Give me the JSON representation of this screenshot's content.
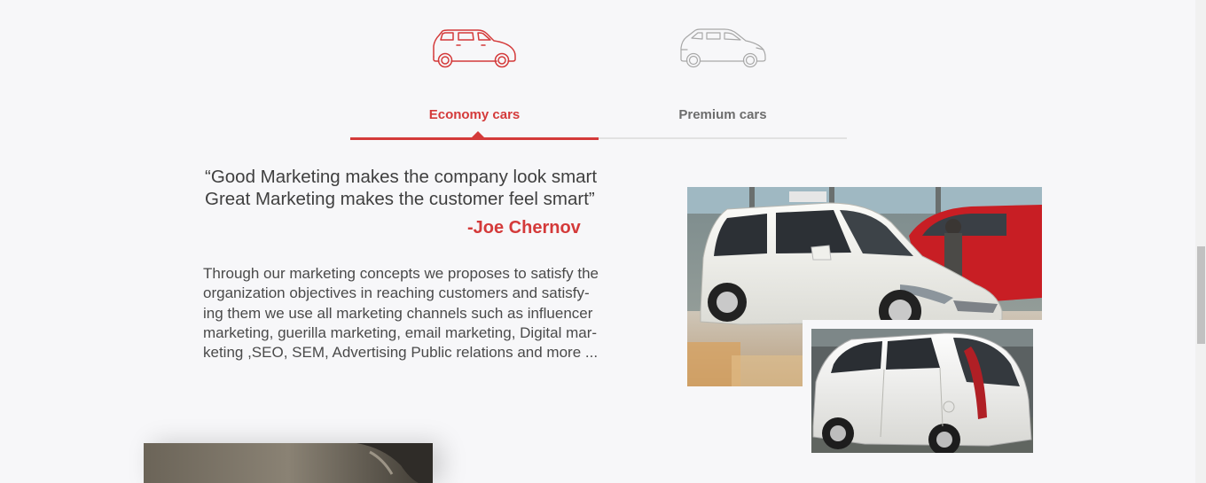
{
  "tabs": {
    "economy": {
      "label": "Economy cars",
      "active": true,
      "color": "#d43a3a"
    },
    "premium": {
      "label": "Premium cars",
      "active": false,
      "color": "#6d6d6d"
    }
  },
  "quote": {
    "line1": "“Good Marketing makes the company look smart",
    "line2": "Great Marketing makes the customer feel smart”",
    "author": "-Joe Chernov"
  },
  "description": {
    "lines": [
      "Through our marketing concepts we proposes to satisfy the",
      "organization objectives in reaching customers and satisfy-",
      "ing them we use all marketing channels such as influencer",
      "marketing, guerilla marketing, email marketing, Digital mar-",
      "keting ,SEO, SEM, Advertising Public relations and more ..."
    ]
  },
  "colors": {
    "accent": "#d43a3a",
    "background": "#f7f7f9",
    "text": "#3f3f3f"
  },
  "icons": {
    "economy": "hatchback-car-icon",
    "premium": "suv-car-icon"
  }
}
